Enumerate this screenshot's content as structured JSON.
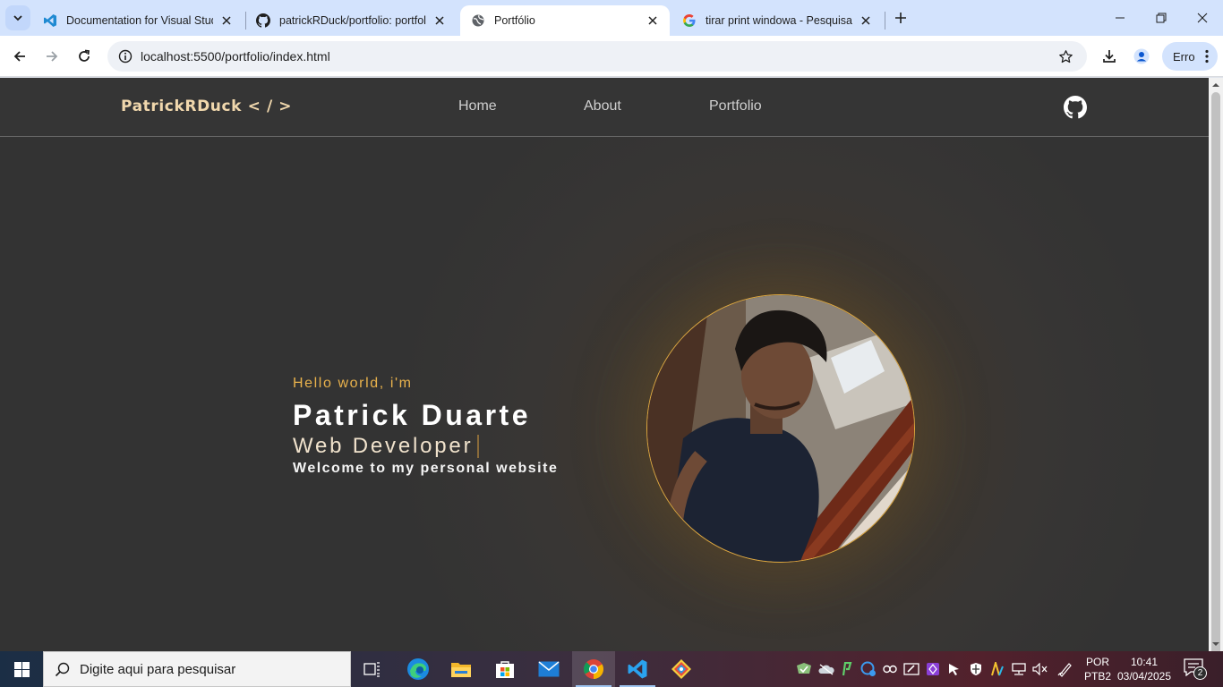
{
  "browser": {
    "tabs": [
      {
        "title": "Documentation for Visual Studio Code",
        "icon": "vscode-icon",
        "active": false
      },
      {
        "title": "patrickRDuck/portfolio: portfolio",
        "icon": "github-icon",
        "active": false
      },
      {
        "title": "Portfólio",
        "icon": "globe-icon",
        "active": true
      },
      {
        "title": "tirar print windowa - Pesquisa Google",
        "icon": "google-icon",
        "active": false
      }
    ],
    "url": "localhost:5500/portfolio/index.html",
    "profile_label": "Erro"
  },
  "site": {
    "brand": "PatrickRDuck < / >",
    "nav": [
      "Home",
      "About",
      "Portfolio"
    ],
    "hero": {
      "greeting": "Hello world, i'm",
      "name": "Patrick Duarte",
      "role": "Web Developer",
      "tagline": "Welcome to my personal website"
    }
  },
  "taskbar": {
    "search_placeholder": "Digite aqui para pesquisar",
    "language": "POR",
    "keyboard": "PTB2",
    "time": "10:41",
    "date": "03/04/2025",
    "notification_count": "2"
  },
  "colors": {
    "accent": "#e9b24c",
    "page_bg": "#333333",
    "brand_text": "#f1d8ad"
  }
}
